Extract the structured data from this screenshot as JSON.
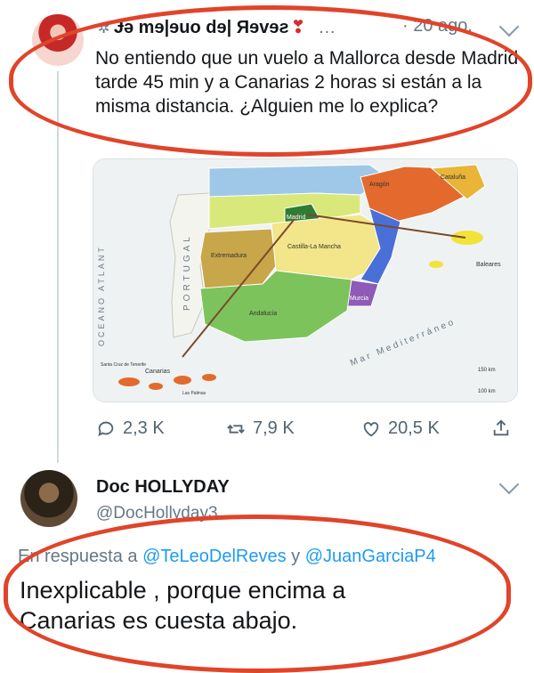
{
  "tweet1": {
    "author_name": "Ɉə mɘ|ɘuo dɘ| Яɘvɘƨ",
    "heart": "❣",
    "dots": "…",
    "date": "· 20 ago.",
    "text": "No entiendo que un vuelo a Mallorca desde Madrid tarde 45 min y a Canarias 2 horas si están a la misma distancia. ¿Alguien me lo explica?",
    "map": {
      "ocean_label": "OCEANO ATLANT",
      "portugal_label": "PORTUGAL",
      "med_label": "Mar Mediterráneo",
      "regions": [
        "Aragón",
        "Cataluña",
        "Madrid",
        "Castilla-La Mancha",
        "Extremadura",
        "Andalucía",
        "Murcia",
        "Baleares",
        "Canarias",
        "Santa Cruz de Tenerife",
        "Las Palmas"
      ],
      "scale_150": "150 km",
      "scale_100": "100 km"
    },
    "actions": {
      "replies": "2,3 K",
      "retweets": "7,9 K",
      "likes": "20,5 K"
    }
  },
  "tweet2": {
    "author_name": "Doc HOLLYDAY",
    "handle": "@DocHollyday3",
    "reply_prefix": "En respuesta a",
    "reply_user1": "@TeLeoDelReves",
    "reply_and": "y",
    "reply_user2": "@JuanGarciaP4",
    "text": "Inexplicable , porque encima a Canarias es cuesta abajo."
  },
  "colors": {
    "annotation": "#e0442a",
    "link": "#1d9bf0",
    "muted": "#657786"
  }
}
